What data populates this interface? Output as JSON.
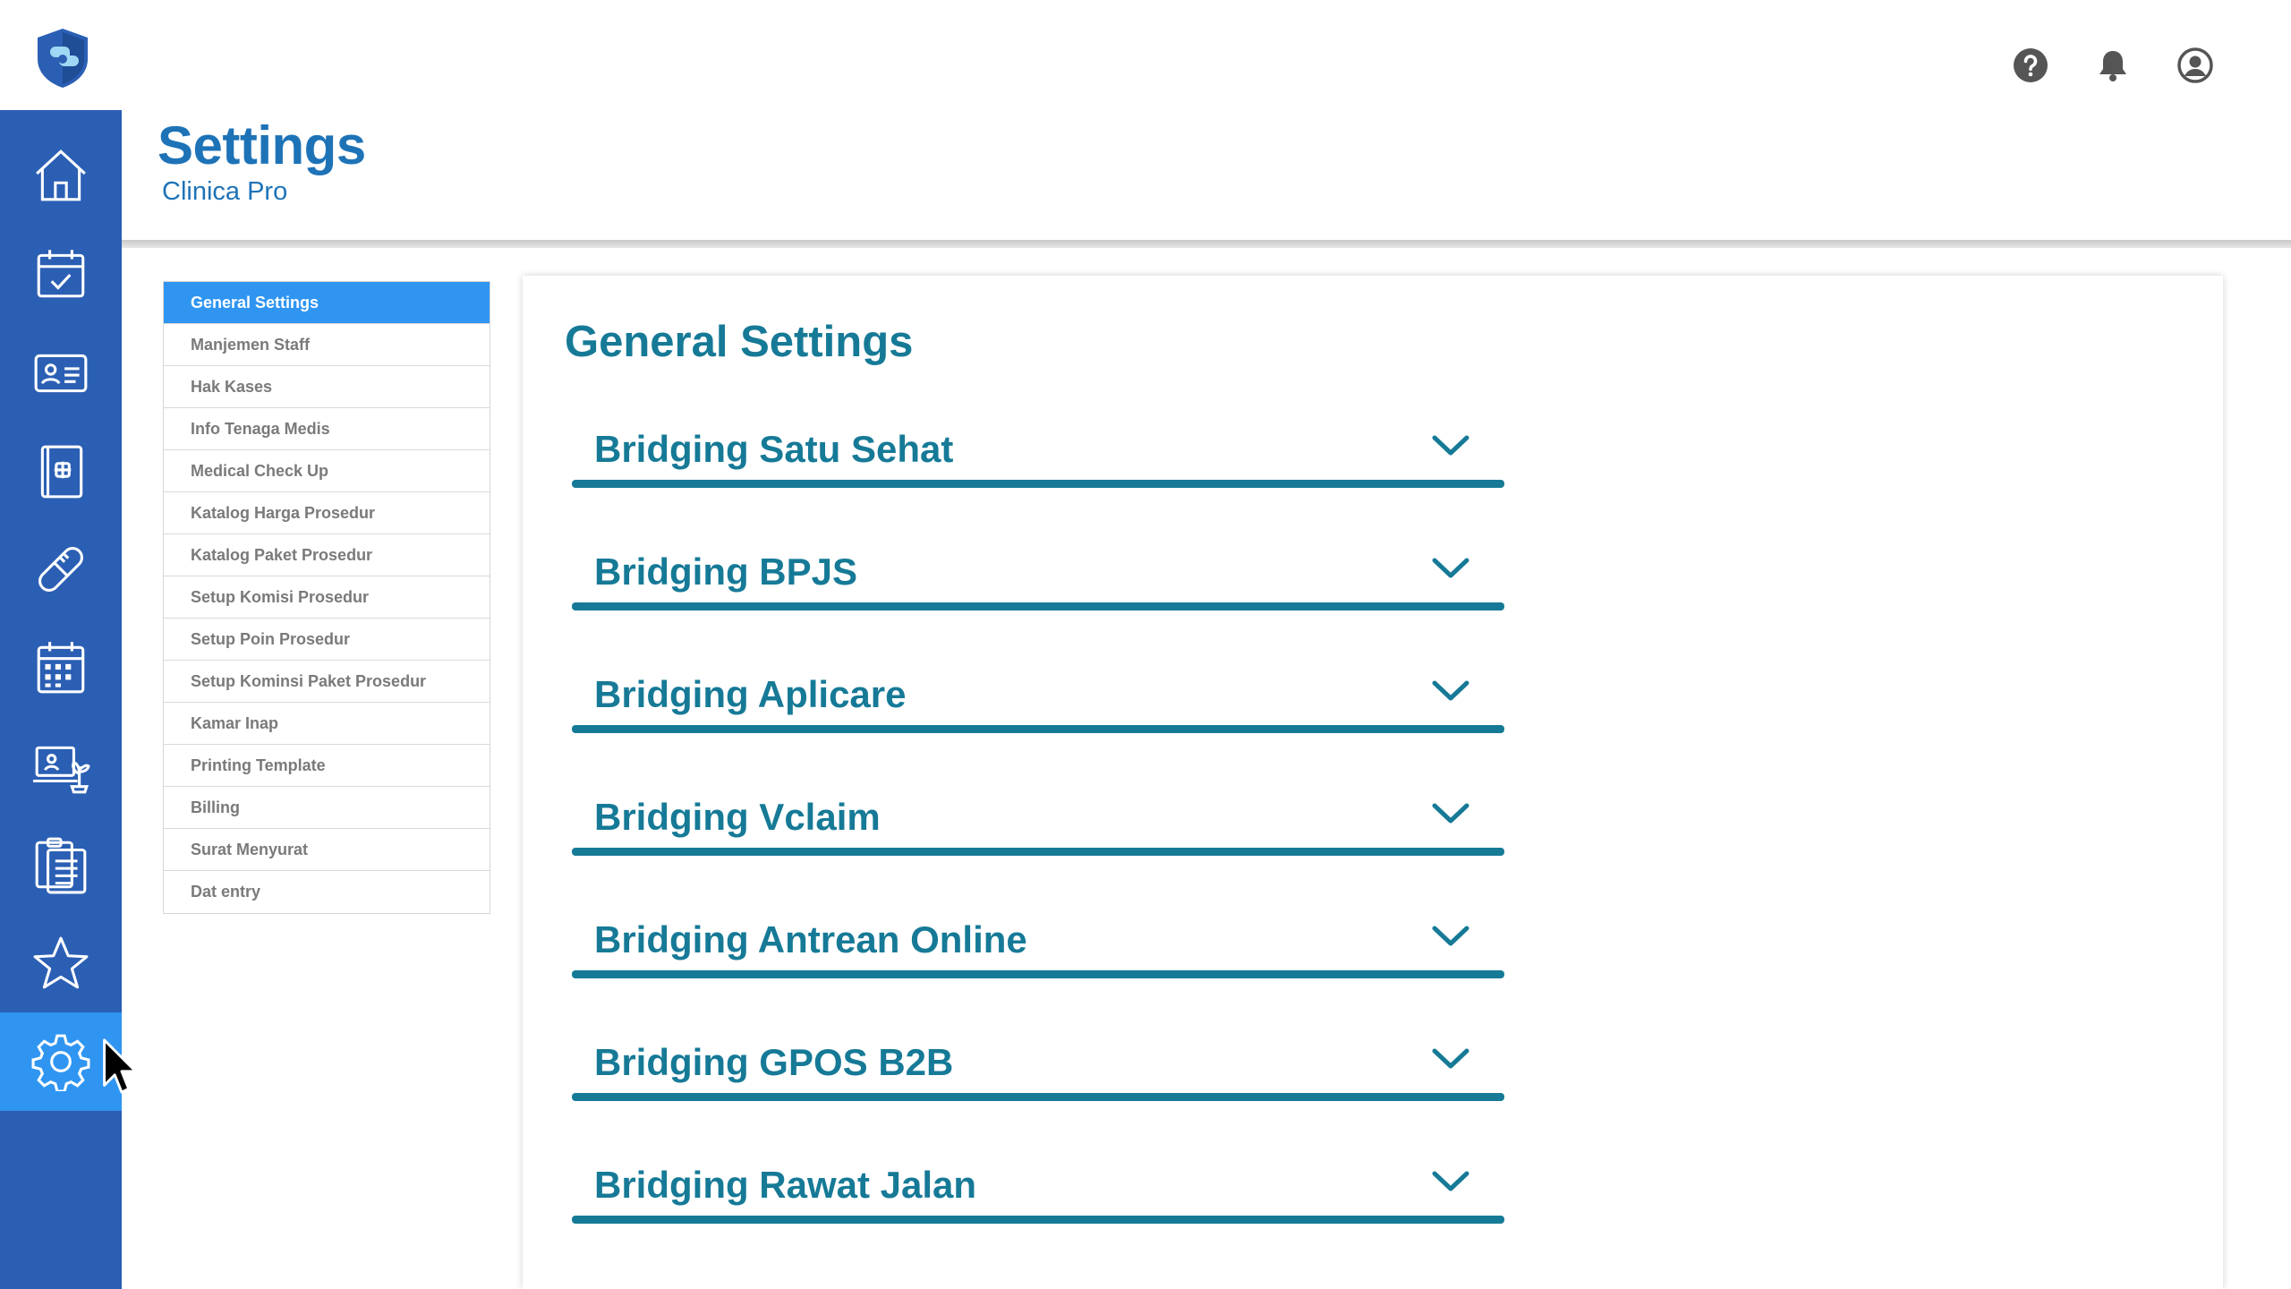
{
  "header": {
    "title": "Settings",
    "subtitle": "Clinica Pro",
    "icons": [
      "help-icon",
      "bell-icon",
      "user-account-icon"
    ]
  },
  "sidebar": {
    "items": [
      {
        "name": "home-icon"
      },
      {
        "name": "calendar-check-icon"
      },
      {
        "name": "id-card-icon"
      },
      {
        "name": "medical-record-icon"
      },
      {
        "name": "pill-icon"
      },
      {
        "name": "schedule-grid-icon"
      },
      {
        "name": "computer-plant-icon"
      },
      {
        "name": "clipboard-list-icon"
      },
      {
        "name": "star-icon"
      },
      {
        "name": "gear-icon",
        "active": true
      }
    ]
  },
  "settings_menu": {
    "items": [
      {
        "label": "General Settings",
        "active": true
      },
      {
        "label": "Manjemen Staff"
      },
      {
        "label": "Hak Kases"
      },
      {
        "label": "Info Tenaga Medis"
      },
      {
        "label": "Medical Check Up"
      },
      {
        "label": "Katalog Harga Prosedur"
      },
      {
        "label": "Katalog Paket Prosedur"
      },
      {
        "label": "Setup Komisi Prosedur"
      },
      {
        "label": "Setup Poin Prosedur"
      },
      {
        "label": "Setup Kominsi Paket Prosedur"
      },
      {
        "label": "Kamar Inap"
      },
      {
        "label": "Printing Template"
      },
      {
        "label": "Billing"
      },
      {
        "label": "Surat Menyurat"
      },
      {
        "label": "Dat entry"
      }
    ]
  },
  "main": {
    "title": "General Settings",
    "sections": [
      {
        "label": "Bridging Satu Sehat"
      },
      {
        "label": "Bridging BPJS"
      },
      {
        "label": "Bridging Aplicare"
      },
      {
        "label": "Bridging Vclaim"
      },
      {
        "label": "Bridging Antrean Online"
      },
      {
        "label": "Bridging GPOS B2B"
      },
      {
        "label": "Bridging Rawat Jalan"
      }
    ]
  },
  "colors": {
    "sidebar": "#2b5fb4",
    "active": "#2f95f1",
    "accent": "#167a97",
    "title": "#1e73b7"
  }
}
